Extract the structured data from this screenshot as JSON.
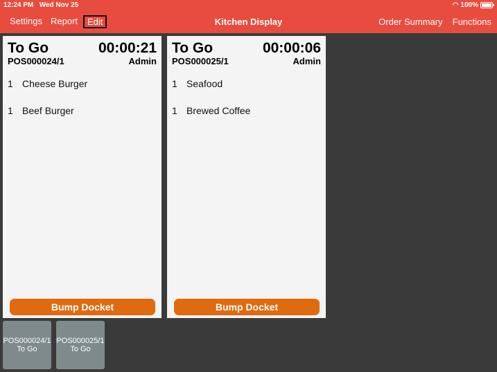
{
  "status_bar": {
    "time": "12:24 PM",
    "date": "Wed Nov 25",
    "battery": "100%"
  },
  "header": {
    "left_menu": [
      "Settings",
      "Report",
      "Edit"
    ],
    "title": "Kitchen Display",
    "right_menu": [
      "Order Summary",
      "Functions"
    ],
    "accent_color": "#e84c3f"
  },
  "dockets": [
    {
      "type": "To Go",
      "timer": "00:00:21",
      "order_no": "POS000024/1",
      "user": "Admin",
      "items": [
        {
          "qty": "1",
          "name": "Cheese Burger"
        },
        {
          "qty": "1",
          "name": "Beef Burger"
        }
      ],
      "bump_label": "Bump Docket"
    },
    {
      "type": "To Go",
      "timer": "00:00:06",
      "order_no": "POS000025/1",
      "user": "Admin",
      "items": [
        {
          "qty": "1",
          "name": "Seafood"
        },
        {
          "qty": "1",
          "name": "Brewed Coffee"
        }
      ],
      "bump_label": "Bump Docket"
    }
  ],
  "thumbnails": [
    {
      "order_no": "POS000024/1",
      "type": "To Go"
    },
    {
      "order_no": "POS000025/1",
      "type": "To Go"
    }
  ],
  "colors": {
    "bump_button": "#e06a10",
    "thumbnail": "#7e8a8b",
    "background": "#3a3a3a"
  }
}
